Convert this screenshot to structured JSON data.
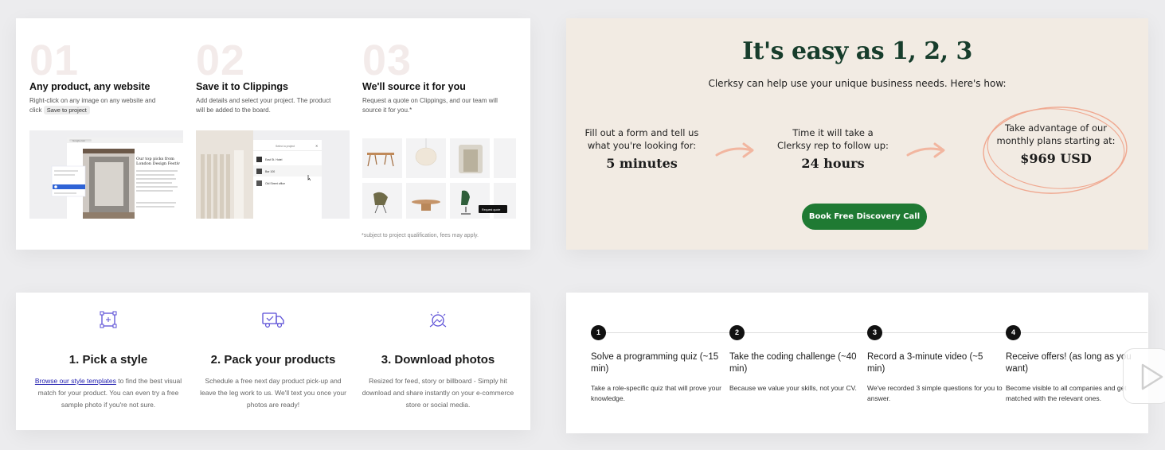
{
  "clippings": {
    "steps": [
      {
        "num": "01",
        "title": "Any product, any website",
        "desc": "Right-click on any image on any website and click",
        "chip": "Save to project"
      },
      {
        "num": "02",
        "title": "Save it to Clippings",
        "desc": "Add details and select your project. The product will be added to the board."
      },
      {
        "num": "03",
        "title": "We'll source it for you",
        "desc": "Request a quote on Clippings, and our team will source it for you.*"
      }
    ],
    "footnote": "*subject to project qualification, fees may apply.",
    "mock": {
      "browser_bar": "Google.com",
      "headline": "Our top picks from London Design Festiv",
      "select_project": "Select a project",
      "projects": [
        "East St. Hotel",
        "Bar 100",
        "Old Street office"
      ],
      "request_quote": "Request quote"
    }
  },
  "clerksy": {
    "title": "It's easy as 1, 2, 3",
    "subtitle": "Clerksy can help use your unique business needs. Here's how:",
    "steps": [
      {
        "label": "Fill out a form and tell us what you're looking for:",
        "value": "5 minutes"
      },
      {
        "label": "Time it will take a Clerksy rep to follow up:",
        "value": "24 hours"
      },
      {
        "label": "Take advantage of our monthly plans starting at:",
        "value": "$969 USD"
      }
    ],
    "cta": "Book Free Discovery Call",
    "colors": {
      "bg": "#f2ebe3",
      "accent": "#1f7a33",
      "arrow": "#f2b6a0"
    }
  },
  "photo": {
    "steps": [
      {
        "icon": "crop-frame-icon",
        "title": "1. Pick a style",
        "link": "Browse our style templates",
        "desc": " to find the best visual match for your product. You can even try a free sample photo if you're not sure."
      },
      {
        "icon": "delivery-truck-icon",
        "title": "2. Pack your products",
        "desc": "Schedule a free next day product pick-up and leave the leg work to us. We'll text you once your photos are ready!"
      },
      {
        "icon": "download-photo-icon",
        "title": "3. Download photos",
        "desc": "Resized for feed, story or billboard - Simply hit download and share instantly on your e-commerce store or social media."
      }
    ]
  },
  "coding": {
    "steps": [
      {
        "num": "1",
        "title": "Solve a programming quiz (~15 min)",
        "desc": "Take a role-specific quiz that will prove your knowledge."
      },
      {
        "num": "2",
        "title": "Take the coding challenge (~40 min)",
        "desc": "Because we value your skills, not your CV."
      },
      {
        "num": "3",
        "title": "Record a 3-minute video (~5 min)",
        "desc": "We've recorded 3 simple questions for you to answer."
      },
      {
        "num": "4",
        "title": "Receive offers! (as long as you want)",
        "desc": "Become visible to all companies and get matched with the relevant ones."
      }
    ]
  }
}
